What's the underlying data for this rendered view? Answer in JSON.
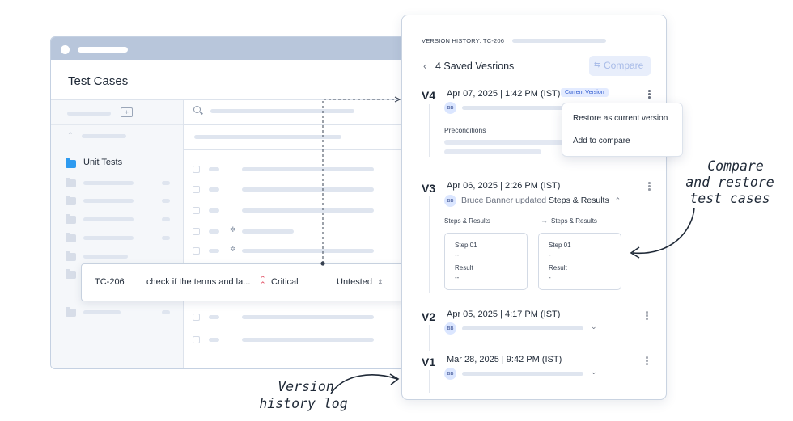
{
  "left_window": {
    "title": "Test Cases",
    "folder_label": "Unit Tests",
    "row": {
      "id": "TC-206",
      "title": "check if the terms and la...",
      "priority_icon": "double-chevron-up-icon",
      "priority": "Critical",
      "status": "Untested",
      "status_icon": "updown-chevron-icon"
    }
  },
  "panel": {
    "header": "VERSION HISTORY: TC-206 |",
    "back_icon": "chevron-left-icon",
    "saved_title": "4 Saved Vesrions",
    "compare_label": "Compare",
    "compare_icon": "compare-icon",
    "versions": [
      {
        "tag": "V4",
        "date": "Apr 07, 2025 | 1:42 PM (IST)",
        "badge": "Current Version",
        "avatar": "BB",
        "section": "Preconditions"
      },
      {
        "tag": "V3",
        "date": "Apr 06, 2025 | 2:26 PM (IST)",
        "avatar": "BB",
        "user": "Bruce Banner updated",
        "changed": "Steps & Results",
        "left_label": "Steps & Results",
        "right_label": "Steps & Results",
        "left_box": {
          "step": "Step 01",
          "step_val": "--",
          "result": "Result",
          "result_val": "--"
        },
        "right_box": {
          "step": "Step 01",
          "step_val": "-",
          "result": "Result",
          "result_val": "-"
        }
      },
      {
        "tag": "V2",
        "date": "Apr 05, 2025 | 4:17 PM (IST)",
        "avatar": "BB"
      },
      {
        "tag": "V1",
        "date": "Mar 28, 2025 | 9:42 PM (IST)",
        "avatar": "BB"
      }
    ],
    "menu": [
      "Restore as current version",
      "Add to compare"
    ]
  },
  "annotations": {
    "right": [
      "Compare",
      "and restore",
      "test cases"
    ],
    "bottom": [
      "Version",
      "history log"
    ]
  },
  "colors": {
    "accent": "#2f5bd0",
    "folder_blue": "#2e9bf0",
    "critical_red": "#e0445a",
    "window_bar": "#b8c6db"
  }
}
